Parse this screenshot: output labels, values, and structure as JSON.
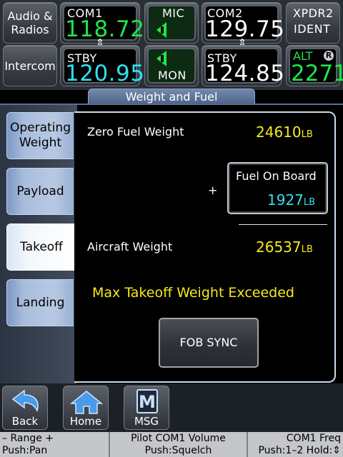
{
  "top": {
    "audio_label_1": "Audio &",
    "audio_label_2": "Radios",
    "intercom_label": "Intercom",
    "com1": {
      "label": "COM1",
      "active": "118.72",
      "stby_label": "STBY",
      "standby": "120.95",
      "swap": "⇕"
    },
    "mic": {
      "label": "MIC",
      "mon_label": "MON"
    },
    "com2": {
      "label": "COM2",
      "active": "129.75",
      "stby_label": "STBY",
      "standby": "124.85",
      "swap": "⇕"
    },
    "xpdr": {
      "label": "XPDR2",
      "ident": "IDENT",
      "mode": "ALT",
      "r_badge": "R",
      "code": "2271"
    }
  },
  "page": {
    "title": "Weight and Fuel"
  },
  "tabs": [
    {
      "label_1": "Operating",
      "label_2": "Weight"
    },
    {
      "label": "Payload"
    },
    {
      "label": "Takeoff"
    },
    {
      "label": "Landing"
    }
  ],
  "panel": {
    "zfw_label": "Zero Fuel Weight",
    "zfw_value": "24610",
    "plus": "+",
    "fob_label": "Fuel On Board",
    "fob_value": "1927",
    "aw_label": "Aircraft Weight",
    "aw_value": "26537",
    "unit": "LB",
    "warning": "Max Takeoff Weight Exceeded",
    "sync_label": "FOB SYNC"
  },
  "bottom": {
    "back_label": "Back",
    "home_label": "Home",
    "msg_label": "MSG",
    "msg_icon": "M"
  },
  "status": {
    "left_1": "– Range +",
    "left_2": "Push:Pan",
    "mid_1": "Pilot COM1 Volume",
    "mid_2": "Push:Squelch",
    "right_1": "COM1 Freq",
    "right_2": "Push:1–2 Hold:⇕"
  },
  "colors": {
    "active_green": "#1fe64a",
    "standby_cyan": "#2fe0ef",
    "value_yellow": "#f6ea1a",
    "tab_blue": "#a8bddc"
  }
}
